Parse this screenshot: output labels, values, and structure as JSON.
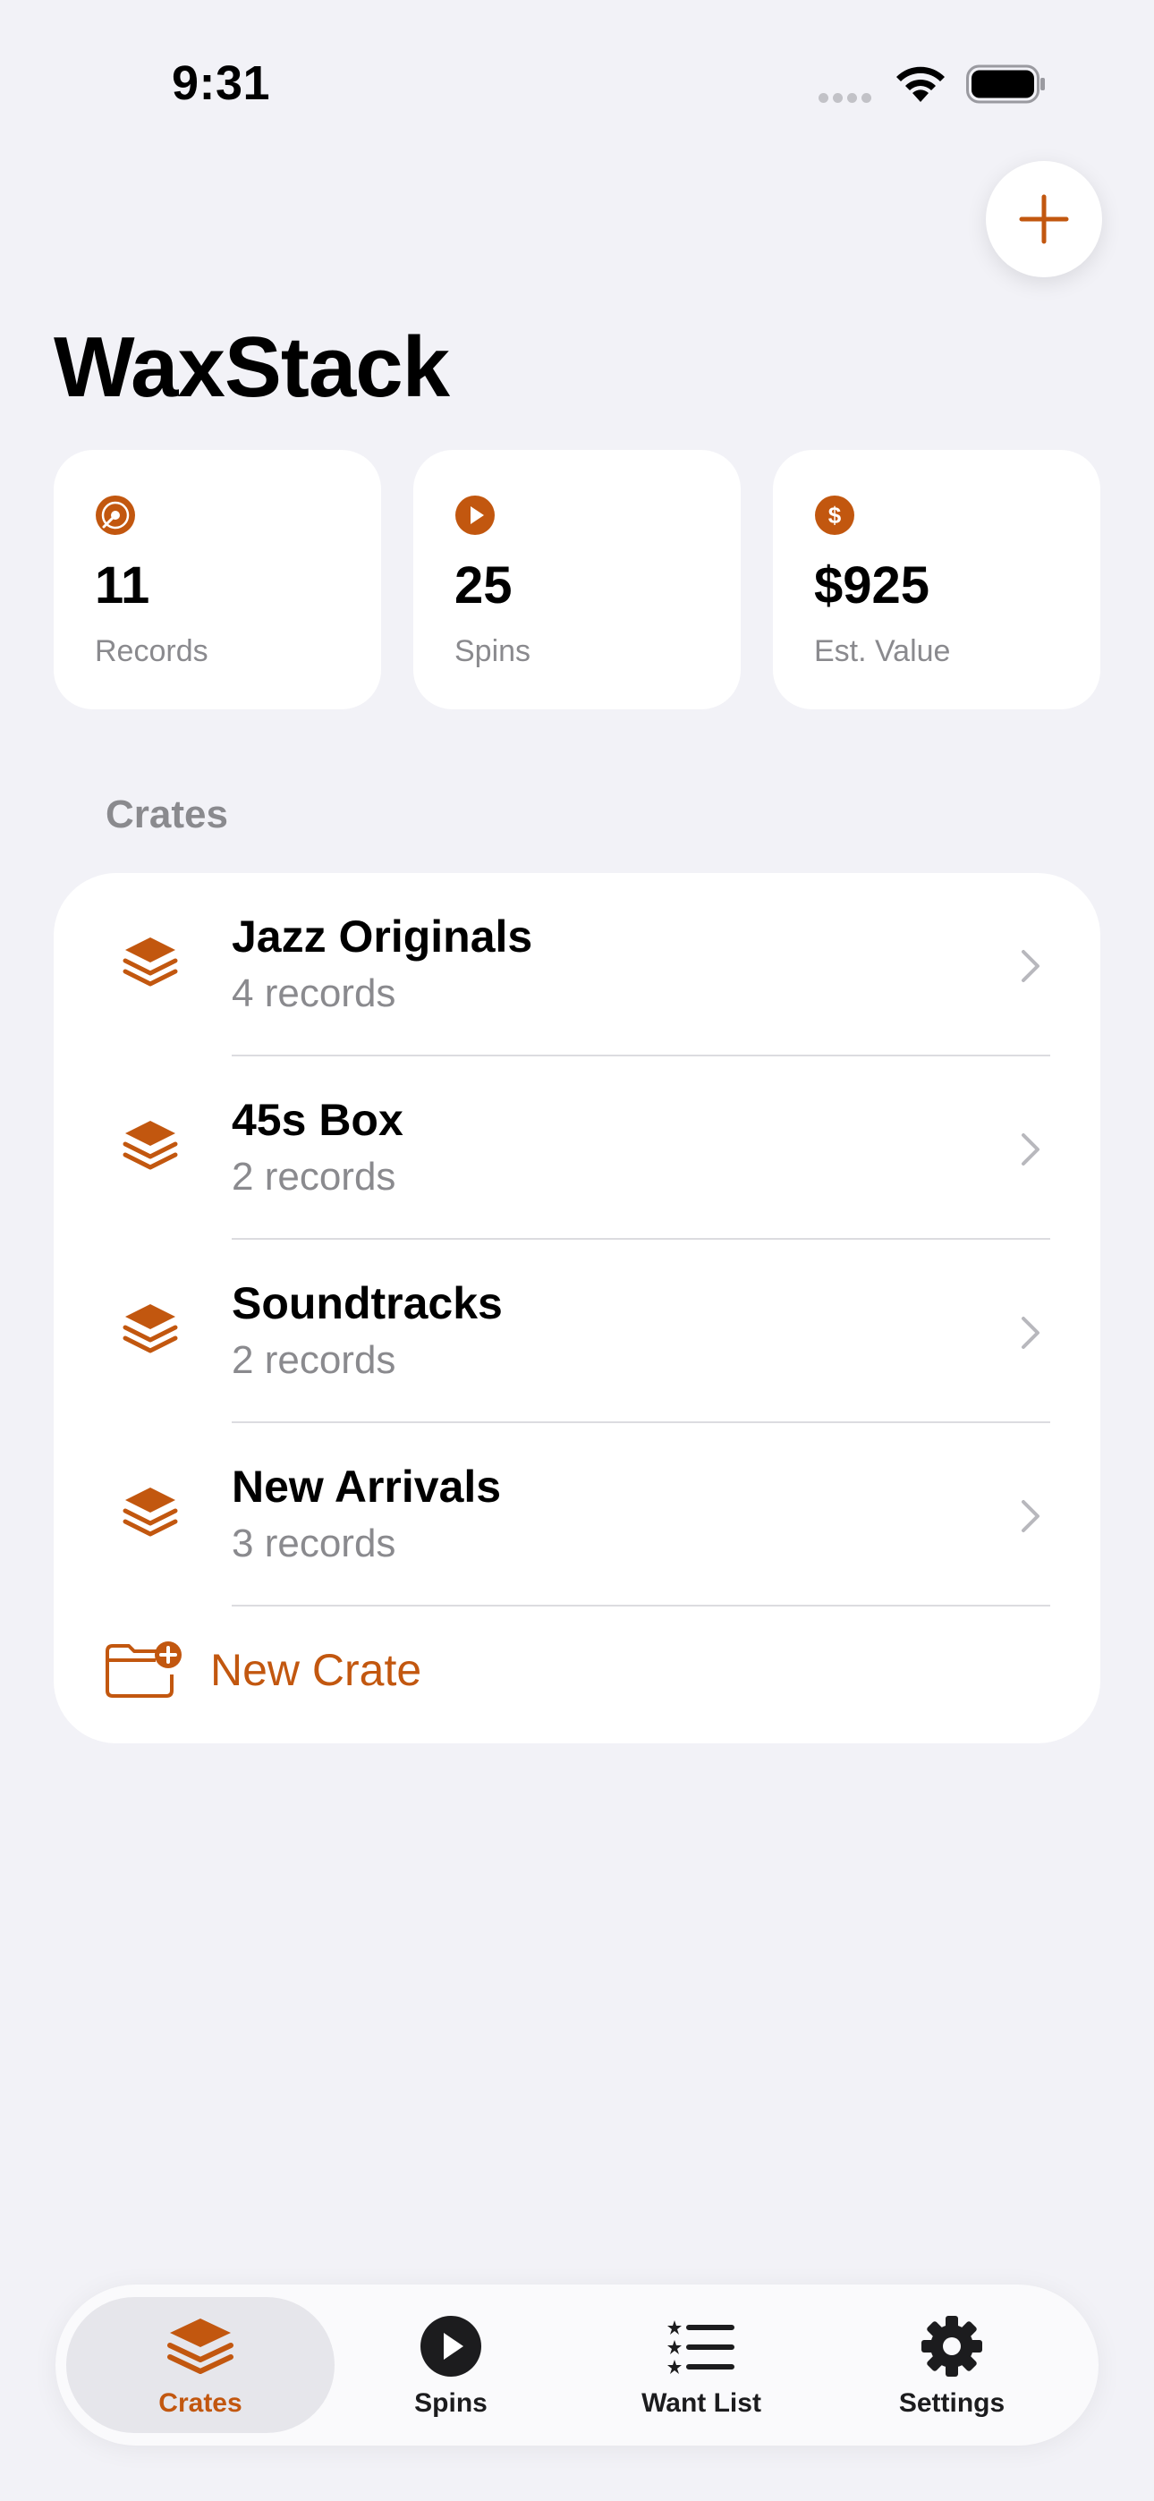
{
  "status_bar": {
    "time": "9:31"
  },
  "app": {
    "title": "WaxStack"
  },
  "colors": {
    "accent": "#c2570f",
    "background": "#f2f2f7",
    "card": "#ffffff",
    "secondary_text": "#8a8a8e"
  },
  "stats": [
    {
      "icon": "vinyl-record-icon",
      "value": "11",
      "label": "Records"
    },
    {
      "icon": "play-circle-icon",
      "value": "25",
      "label": "Spins"
    },
    {
      "icon": "dollar-circle-icon",
      "value": "$925",
      "label": "Est. Value"
    }
  ],
  "crates": {
    "header": "Crates",
    "items": [
      {
        "name": "Jazz Originals",
        "count": "4 records",
        "icon": "stack-icon"
      },
      {
        "name": "45s Box",
        "count": "2 records",
        "icon": "stack-icon"
      },
      {
        "name": "Soundtracks",
        "count": "2 records",
        "icon": "stack-icon"
      },
      {
        "name": "New Arrivals",
        "count": "3 records",
        "icon": "stack-icon"
      }
    ],
    "new_crate_label": "New Crate"
  },
  "tab_bar": {
    "items": [
      {
        "label": "Crates",
        "icon": "stack-icon",
        "active": true
      },
      {
        "label": "Spins",
        "icon": "play-circle-icon",
        "active": false
      },
      {
        "label": "Want List",
        "icon": "list-star-icon",
        "active": false
      },
      {
        "label": "Settings",
        "icon": "gear-icon",
        "active": false
      }
    ]
  }
}
